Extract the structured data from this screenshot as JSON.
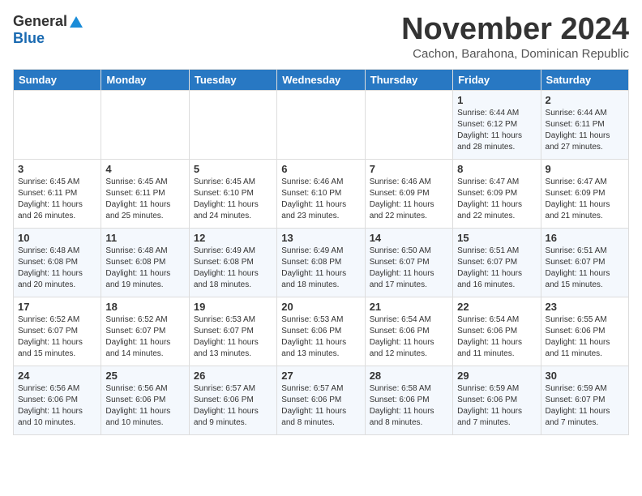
{
  "header": {
    "logo_general": "General",
    "logo_blue": "Blue",
    "month_title": "November 2024",
    "location": "Cachon, Barahona, Dominican Republic"
  },
  "days_of_week": [
    "Sunday",
    "Monday",
    "Tuesday",
    "Wednesday",
    "Thursday",
    "Friday",
    "Saturday"
  ],
  "weeks": [
    [
      {
        "day": "",
        "info": ""
      },
      {
        "day": "",
        "info": ""
      },
      {
        "day": "",
        "info": ""
      },
      {
        "day": "",
        "info": ""
      },
      {
        "day": "",
        "info": ""
      },
      {
        "day": "1",
        "info": "Sunrise: 6:44 AM\nSunset: 6:12 PM\nDaylight: 11 hours\nand 28 minutes."
      },
      {
        "day": "2",
        "info": "Sunrise: 6:44 AM\nSunset: 6:11 PM\nDaylight: 11 hours\nand 27 minutes."
      }
    ],
    [
      {
        "day": "3",
        "info": "Sunrise: 6:45 AM\nSunset: 6:11 PM\nDaylight: 11 hours\nand 26 minutes."
      },
      {
        "day": "4",
        "info": "Sunrise: 6:45 AM\nSunset: 6:11 PM\nDaylight: 11 hours\nand 25 minutes."
      },
      {
        "day": "5",
        "info": "Sunrise: 6:45 AM\nSunset: 6:10 PM\nDaylight: 11 hours\nand 24 minutes."
      },
      {
        "day": "6",
        "info": "Sunrise: 6:46 AM\nSunset: 6:10 PM\nDaylight: 11 hours\nand 23 minutes."
      },
      {
        "day": "7",
        "info": "Sunrise: 6:46 AM\nSunset: 6:09 PM\nDaylight: 11 hours\nand 22 minutes."
      },
      {
        "day": "8",
        "info": "Sunrise: 6:47 AM\nSunset: 6:09 PM\nDaylight: 11 hours\nand 22 minutes."
      },
      {
        "day": "9",
        "info": "Sunrise: 6:47 AM\nSunset: 6:09 PM\nDaylight: 11 hours\nand 21 minutes."
      }
    ],
    [
      {
        "day": "10",
        "info": "Sunrise: 6:48 AM\nSunset: 6:08 PM\nDaylight: 11 hours\nand 20 minutes."
      },
      {
        "day": "11",
        "info": "Sunrise: 6:48 AM\nSunset: 6:08 PM\nDaylight: 11 hours\nand 19 minutes."
      },
      {
        "day": "12",
        "info": "Sunrise: 6:49 AM\nSunset: 6:08 PM\nDaylight: 11 hours\nand 18 minutes."
      },
      {
        "day": "13",
        "info": "Sunrise: 6:49 AM\nSunset: 6:08 PM\nDaylight: 11 hours\nand 18 minutes."
      },
      {
        "day": "14",
        "info": "Sunrise: 6:50 AM\nSunset: 6:07 PM\nDaylight: 11 hours\nand 17 minutes."
      },
      {
        "day": "15",
        "info": "Sunrise: 6:51 AM\nSunset: 6:07 PM\nDaylight: 11 hours\nand 16 minutes."
      },
      {
        "day": "16",
        "info": "Sunrise: 6:51 AM\nSunset: 6:07 PM\nDaylight: 11 hours\nand 15 minutes."
      }
    ],
    [
      {
        "day": "17",
        "info": "Sunrise: 6:52 AM\nSunset: 6:07 PM\nDaylight: 11 hours\nand 15 minutes."
      },
      {
        "day": "18",
        "info": "Sunrise: 6:52 AM\nSunset: 6:07 PM\nDaylight: 11 hours\nand 14 minutes."
      },
      {
        "day": "19",
        "info": "Sunrise: 6:53 AM\nSunset: 6:07 PM\nDaylight: 11 hours\nand 13 minutes."
      },
      {
        "day": "20",
        "info": "Sunrise: 6:53 AM\nSunset: 6:06 PM\nDaylight: 11 hours\nand 13 minutes."
      },
      {
        "day": "21",
        "info": "Sunrise: 6:54 AM\nSunset: 6:06 PM\nDaylight: 11 hours\nand 12 minutes."
      },
      {
        "day": "22",
        "info": "Sunrise: 6:54 AM\nSunset: 6:06 PM\nDaylight: 11 hours\nand 11 minutes."
      },
      {
        "day": "23",
        "info": "Sunrise: 6:55 AM\nSunset: 6:06 PM\nDaylight: 11 hours\nand 11 minutes."
      }
    ],
    [
      {
        "day": "24",
        "info": "Sunrise: 6:56 AM\nSunset: 6:06 PM\nDaylight: 11 hours\nand 10 minutes."
      },
      {
        "day": "25",
        "info": "Sunrise: 6:56 AM\nSunset: 6:06 PM\nDaylight: 11 hours\nand 10 minutes."
      },
      {
        "day": "26",
        "info": "Sunrise: 6:57 AM\nSunset: 6:06 PM\nDaylight: 11 hours\nand 9 minutes."
      },
      {
        "day": "27",
        "info": "Sunrise: 6:57 AM\nSunset: 6:06 PM\nDaylight: 11 hours\nand 8 minutes."
      },
      {
        "day": "28",
        "info": "Sunrise: 6:58 AM\nSunset: 6:06 PM\nDaylight: 11 hours\nand 8 minutes."
      },
      {
        "day": "29",
        "info": "Sunrise: 6:59 AM\nSunset: 6:06 PM\nDaylight: 11 hours\nand 7 minutes."
      },
      {
        "day": "30",
        "info": "Sunrise: 6:59 AM\nSunset: 6:07 PM\nDaylight: 11 hours\nand 7 minutes."
      }
    ]
  ]
}
